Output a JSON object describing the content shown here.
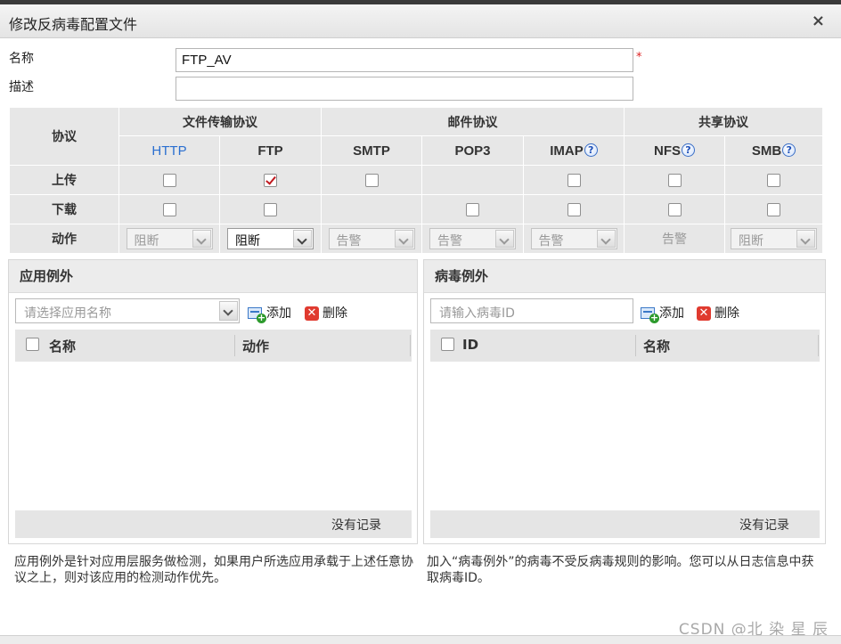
{
  "dialog": {
    "title": "修改反病毒配置文件",
    "close": "×"
  },
  "form": {
    "name_label": "名称",
    "name_value": "FTP_AV",
    "required_mark": "*",
    "desc_label": "描述",
    "desc_value": ""
  },
  "protocols": {
    "protocol_header": "协议",
    "groups": {
      "file": "文件传输协议",
      "mail": "邮件协议",
      "share": "共享协议"
    },
    "names": {
      "http": "HTTP",
      "ftp": "FTP",
      "smtp": "SMTP",
      "pop3": "POP3",
      "imap": "IMAP",
      "nfs": "NFS",
      "smb": "SMB"
    },
    "help_glyph": "?",
    "rows": {
      "upload": "上传",
      "download": "下载",
      "action": "动作"
    },
    "actions": {
      "http": "阻断",
      "ftp": "阻断",
      "smtp": "告警",
      "pop3": "告警",
      "imap": "告警",
      "nfs": "告警",
      "smb": "阻断"
    },
    "upload_checked": {
      "http": false,
      "ftp": true,
      "smtp": false,
      "imap": false,
      "nfs": false,
      "smb": false
    },
    "download_checked": {
      "http": false,
      "ftp": false,
      "pop3": false,
      "imap": false,
      "nfs": false,
      "smb": false
    }
  },
  "app_exception": {
    "title": "应用例外",
    "select_placeholder": "请选择应用名称",
    "add": "添加",
    "delete": "删除",
    "col_name": "名称",
    "col_action": "动作",
    "empty": "没有记录",
    "note": "应用例外是针对应用层服务做检测，如果用户所选应用承载于上述任意协议之上，则对该应用的检测动作优先。"
  },
  "virus_exception": {
    "title": "病毒例外",
    "input_placeholder": "请输入病毒ID",
    "add": "添加",
    "delete": "删除",
    "col_id": "ID",
    "col_name": "名称",
    "empty": "没有记录",
    "note": "加入“病毒例外”的病毒不受反病毒规则的影响。您可以从日志信息中获取病毒ID。"
  },
  "watermark": "CSDN @北 染 星 辰",
  "icons": [
    "close-icon",
    "help-icon",
    "add-icon",
    "delete-icon",
    "chevron-down-icon",
    "checkbox"
  ]
}
